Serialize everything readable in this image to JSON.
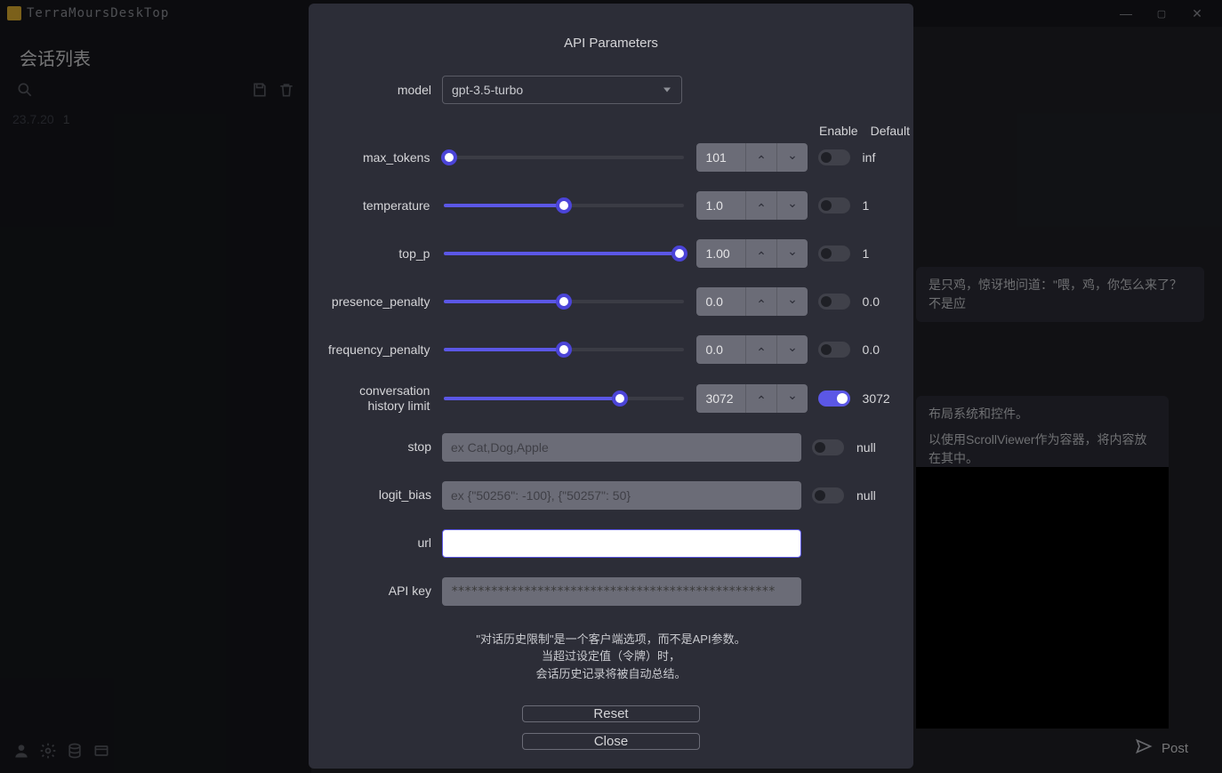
{
  "app_title": "TerraMoursDeskTop",
  "sidebar": {
    "header": "会话列表",
    "date": "23.7.20",
    "date_num": "1"
  },
  "messages": {
    "line1": "是只鸡，惊讶地问道：\"喂，鸡，你怎么来了？不是应",
    "line2": "布局系统和控件。",
    "line3": "以使用ScrollViewer作为容器，将内容放在其中。"
  },
  "composer": {
    "send": "Post"
  },
  "modal": {
    "title": "API Parameters",
    "labels": {
      "model": "model",
      "max_tokens": "max_tokens",
      "temperature": "temperature",
      "top_p": "top_p",
      "presence_penalty": "presence_penalty",
      "frequency_penalty": "frequency_penalty",
      "history": "conversation history limit",
      "stop": "stop",
      "logit_bias": "logit_bias",
      "url": "url",
      "api_key": "API key"
    },
    "headers": {
      "enable": "Enable",
      "default": "Default"
    },
    "model_value": "gpt-3.5-turbo",
    "params": {
      "max_tokens": {
        "value": "101",
        "default": "inf",
        "fill": 2
      },
      "temperature": {
        "value": "1.0",
        "default": "1",
        "fill": 50
      },
      "top_p": {
        "value": "1.00",
        "default": "1",
        "fill": 100
      },
      "presence_penalty": {
        "value": "0.0",
        "default": "0.0",
        "fill": 50
      },
      "frequency_penalty": {
        "value": "0.0",
        "default": "0.0",
        "fill": 50
      },
      "history": {
        "value": "3072",
        "default": "3072",
        "fill": 73,
        "enabled": true
      }
    },
    "stop": {
      "placeholder": "ex Cat,Dog,Apple",
      "default": "null"
    },
    "logit_bias": {
      "placeholder": "ex {\"50256\": -100}, {\"50257\": 50}",
      "default": "null"
    },
    "api_key_value": "*************************************************",
    "help": {
      "l1": "\"对话历史限制\"是一个客户端选项，而不是API参数。",
      "l2": "当超过设定值（令牌）时，",
      "l3": "会话历史记录将被自动总结。"
    },
    "buttons": {
      "reset": "Reset",
      "close": "Close"
    }
  }
}
